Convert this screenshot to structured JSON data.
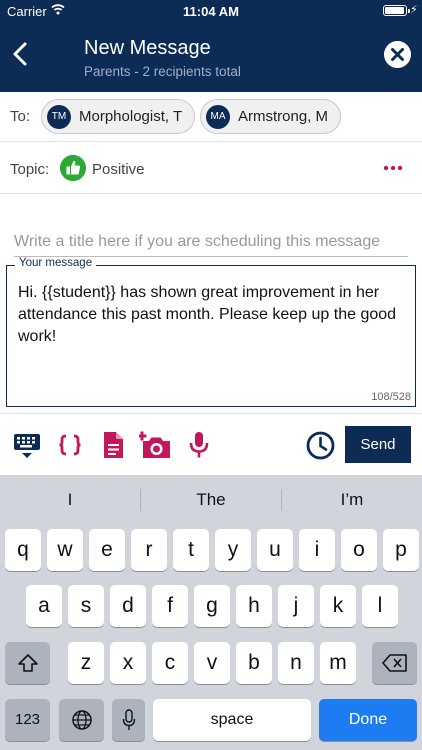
{
  "status_bar": {
    "carrier": "Carrier",
    "time": "11:04 AM",
    "battery_level": 1.0
  },
  "header": {
    "title": "New Message",
    "subtitle": "Parents  - 2 recipients total"
  },
  "recipients": {
    "label": "To:",
    "chips": [
      {
        "initials": "TM",
        "name": "Morphologist, T"
      },
      {
        "initials": "MA",
        "name": "Armstrong, M"
      }
    ]
  },
  "topic": {
    "label": "Topic:",
    "value": "Positive"
  },
  "title_field": {
    "value": "",
    "placeholder": "Write a title here if you are scheduling this message"
  },
  "message": {
    "label": "Your message",
    "text": "Hi. {{student}} has shown great improvement in her attendance this past month. Please keep up the good work!",
    "count": "108/528"
  },
  "toolbar": {
    "send_label": "Send"
  },
  "keyboard": {
    "suggestions": [
      "I",
      "The",
      "I’m"
    ],
    "row1": [
      "q",
      "w",
      "e",
      "r",
      "t",
      "y",
      "u",
      "i",
      "o",
      "p"
    ],
    "row2": [
      "a",
      "s",
      "d",
      "f",
      "g",
      "h",
      "j",
      "k",
      "l"
    ],
    "row3": [
      "z",
      "x",
      "c",
      "v",
      "b",
      "n",
      "m"
    ],
    "numbers_label": "123",
    "space_label": "space",
    "done_label": "Done"
  },
  "colors": {
    "navy": "#0c2b55",
    "accent": "#c2185b",
    "positive": "#2ca834",
    "done": "#1e7cf2"
  }
}
